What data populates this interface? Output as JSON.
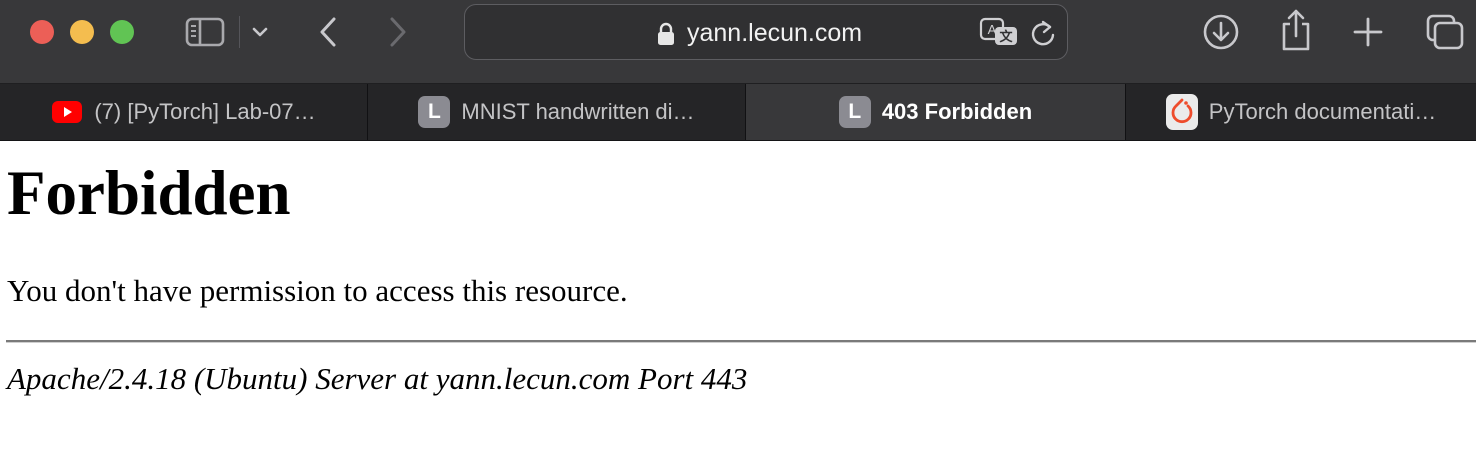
{
  "browser": {
    "address_bar": {
      "url": "yann.lecun.com",
      "secure_icon": "lock-icon",
      "translate_icon": "translate-icon",
      "reload_icon": "reload-icon"
    },
    "toolbar_icons": {
      "sidebar": "sidebar-icon",
      "chevron": "chevron-down-icon",
      "back": "back-icon",
      "forward": "forward-icon",
      "download": "download-icon",
      "share": "share-icon",
      "new_tab": "plus-icon",
      "tab_overview": "tab-overview-icon"
    },
    "window_controls": {
      "close_color": "#ec5f57",
      "minimize_color": "#f4bd4f",
      "zoom_color": "#61c454"
    },
    "tabs": [
      {
        "title": "(7) [PyTorch] Lab-07…",
        "favicon": "youtube-icon",
        "active": false
      },
      {
        "title": "MNIST handwritten di…",
        "favicon": "letter-l-icon",
        "favicon_letter": "L",
        "active": false
      },
      {
        "title": "403 Forbidden",
        "favicon": "letter-l-icon",
        "favicon_letter": "L",
        "active": true
      },
      {
        "title": "PyTorch documentati…",
        "favicon": "pytorch-icon",
        "active": false
      }
    ]
  },
  "page": {
    "heading": "Forbidden",
    "message": "You don't have permission to access this resource.",
    "signature": "Apache/2.4.18 (Ubuntu) Server at yann.lecun.com Port 443"
  },
  "colors": {
    "toolbar_bg": "#38383a",
    "tabstrip_bg": "#252527",
    "youtube_red": "#ff0000",
    "pytorch_orange": "#ee4c2c"
  }
}
